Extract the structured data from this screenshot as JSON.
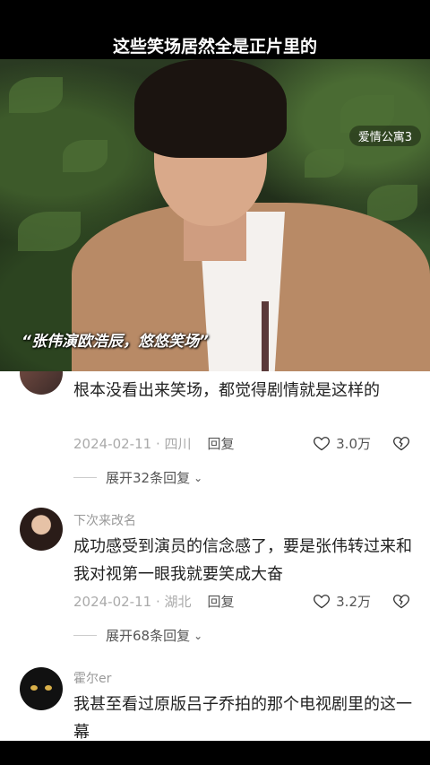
{
  "caption": "这些笑场居然全是正片里的",
  "video": {
    "watermark": "爱情公寓3",
    "subtitle": "“张伟演欧浩辰，悠悠笑场”"
  },
  "comments": [
    {
      "username": "",
      "text": "根本没看出来笑场，都觉得剧情就是这样的",
      "date": "2024-02-11 · 四川",
      "reply_label": "回复",
      "likes": "3.0万",
      "expand": "展开32条回复"
    },
    {
      "username": "下次来改名",
      "text": "成功感受到演员的信念感了，要是张伟转过来和我对视第一眼我就要笑成大奋",
      "date": "2024-02-11 · 湖北",
      "reply_label": "回复",
      "likes": "3.2万",
      "expand": "展开68条回复"
    },
    {
      "username": "霍尔er",
      "text": "我甚至看过原版吕子乔拍的那个电视剧里的这一幕"
    }
  ],
  "icons": {
    "like": "heart-outline-icon",
    "dislike": "broken-heart-icon",
    "expand": "chevron-down-icon"
  }
}
